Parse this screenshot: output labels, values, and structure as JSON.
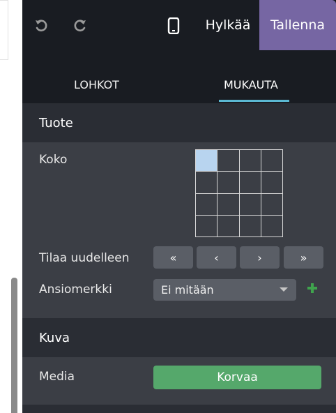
{
  "toolbar": {
    "undo_icon": "undo-icon",
    "redo_icon": "redo-icon",
    "mobile_icon": "mobile-phone-icon",
    "discard_label": "Hylkää",
    "save_label": "Tallenna"
  },
  "tabs": [
    {
      "label": "LOHKOT",
      "active": false
    },
    {
      "label": "MUKAUTA",
      "active": true
    }
  ],
  "product_section": {
    "title": "Tuote",
    "size_label": "Koko",
    "size_grid": {
      "rows": 4,
      "cols": 4,
      "selected_rows": 1,
      "selected_cols": 1
    },
    "reorder_label": "Tilaa uudelleen",
    "reorder_buttons": [
      "«",
      "‹",
      "›",
      "»"
    ],
    "badge_label": "Ansiomerkki",
    "badge_value": "Ei mitään",
    "badge_add_icon": "plus-icon"
  },
  "image_section": {
    "title": "Kuva",
    "media_label": "Media",
    "replace_label": "Korvaa"
  },
  "colors": {
    "panel_bg": "#191c22",
    "section_body": "#3b3e45",
    "save_accent": "#7666a3",
    "tab_underline": "#5bb8d2",
    "replace_button": "#55a86b",
    "add_icon": "#3fa34d"
  }
}
